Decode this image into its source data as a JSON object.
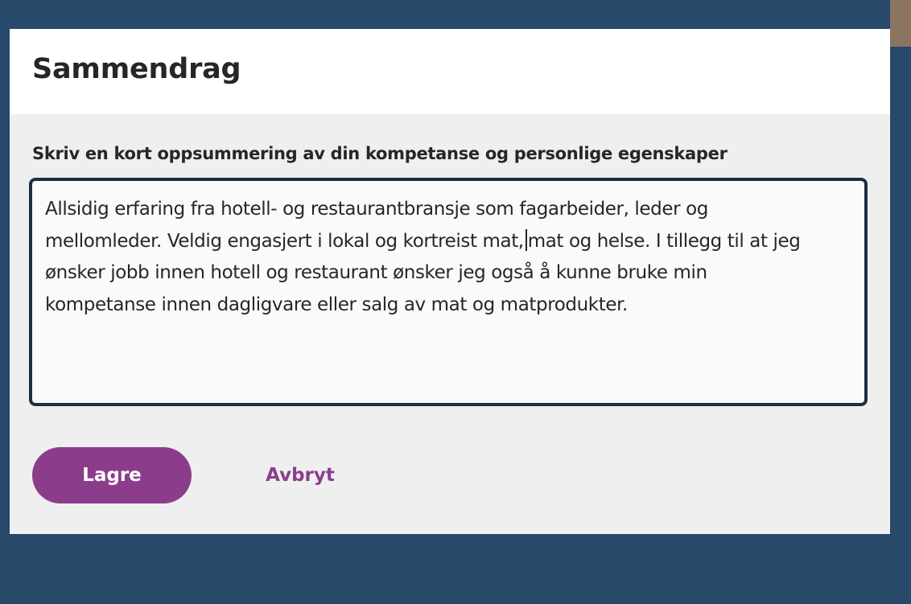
{
  "modal": {
    "title": "Sammendrag",
    "field_label": "Skriv en kort oppsummering av din kompetanse og personlige egenskaper",
    "summary": {
      "line1": "Allsidig erfaring fra hotell- og restaurantbransje som fagarbeider, leder og",
      "line2_before_caret": "mellomleder. Veldig engasjert i lokal og kortreist mat,",
      "line2_after_caret": "mat og helse. I tillegg til at jeg",
      "line3": "ønsker jobb innen hotell og restaurant ønsker jeg også å kunne bruke min",
      "line4": "kompetanse innen dagligvare eller salg av mat og matprodukter."
    },
    "buttons": {
      "save_label": "Lagre",
      "cancel_label": "Avbryt"
    }
  },
  "colors": {
    "backdrop": "#27496a",
    "accent": "#8b3d8c",
    "textarea_border": "#1d2f45"
  }
}
